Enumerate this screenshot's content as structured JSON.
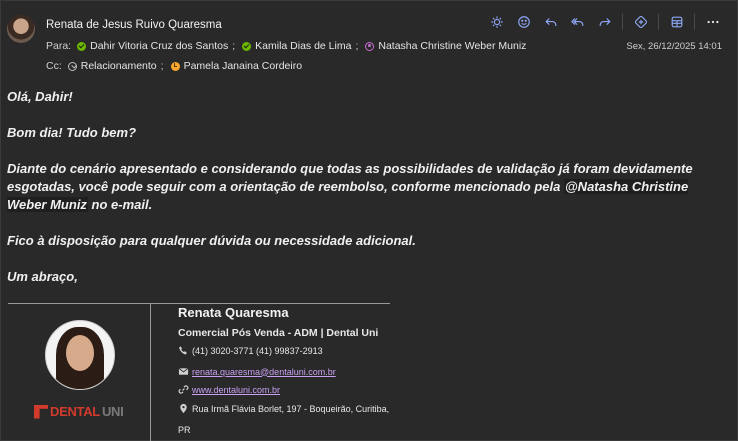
{
  "header": {
    "sender_name": "Renata de Jesus Ruivo Quaresma",
    "date": "Sex, 26/12/2025 14:01",
    "to_label": "Para:",
    "cc_label": "Cc:",
    "to": [
      {
        "name": "Dahir Vitoria Cruz dos Santos",
        "sep": ";",
        "status": "available"
      },
      {
        "name": "Kamila Dias de Lima",
        "sep": ";",
        "status": "available"
      },
      {
        "name": "Natasha Christine Weber Muniz",
        "sep": "",
        "status": "out-of-office"
      }
    ],
    "cc": [
      {
        "name": "Relacionamento",
        "sep": ";",
        "status": "unknown"
      },
      {
        "name": "Pamela Janaina Cordeiro",
        "sep": "",
        "status": "away"
      }
    ]
  },
  "toolbar": {
    "icons": [
      "sun-icon",
      "emoji-icon",
      "reply-icon",
      "reply-all-icon",
      "forward-icon",
      "loop-icon",
      "apps-icon",
      "more-icon"
    ]
  },
  "body": {
    "greeting": "Olá, Dahir!",
    "line2": "Bom dia! Tudo bem?",
    "line3_pre": "Diante do cenário apresentado e considerando que todas as possibilidades de validação já foram devidamente esgotadas, você pode seguir com a orientação de reembolso, conforme mencionado pela ",
    "mention": "@Natasha Christine Weber Muniz",
    "line3_post": " no e-mail.",
    "line4": "Fico à disposição para qualquer dúvida ou necessidade adicional.",
    "closing": "Um abraço,"
  },
  "signature": {
    "name": "Renata Quaresma",
    "role": "Comercial Pós Venda - ADM | Dental Uni",
    "phone": "(41) 3020-3771 (41) 99837-2913",
    "email": "renata.quaresma@dentaluni.com.br",
    "website": "www.dentaluni.com.br",
    "address_line1": "Rua Irmã Flávia Borlet, 197 - Boqueirão, Curitiba,",
    "address_line2": "PR",
    "logo_text_1": "DENTAL",
    "logo_text_2": "UNI"
  },
  "colors": {
    "background": "#292929",
    "link": "#c9a0f2",
    "available": "#6bb700",
    "away": "#f8a82c",
    "oof": "#c66fd1",
    "brand_red": "#d23a2c",
    "toolbar_icon": "#8fa8f5"
  }
}
